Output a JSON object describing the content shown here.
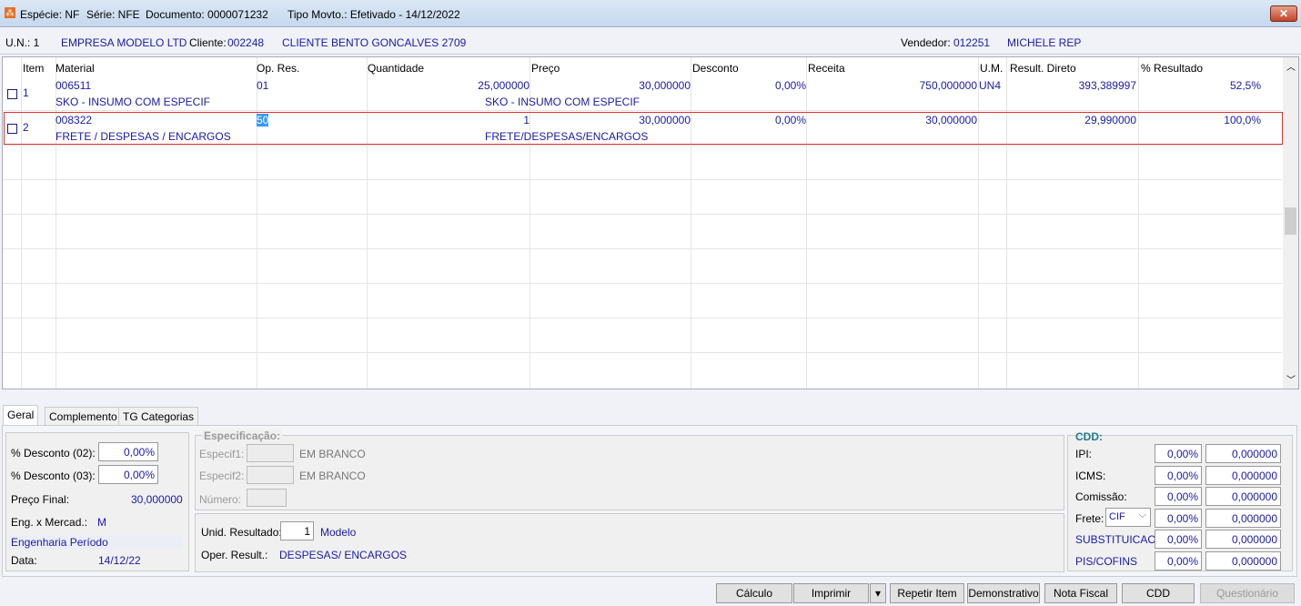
{
  "title": {
    "especie": "Espécie: NF",
    "serie": "Série: NFE",
    "documento": "Documento: 0000071232",
    "tipo": "Tipo Movto.: Efetivado - 14/12/2022",
    "close": "✕"
  },
  "info": {
    "un_label": "U.N.: 1",
    "empresa": "EMPRESA MODELO LTD",
    "cliente_label": "Cliente:",
    "cliente_code": "002248",
    "cliente_name": "CLIENTE BENTO GONCALVES 2709",
    "vendedor_label": "Vendedor:",
    "vendedor_code": "012251",
    "vendedor_name": "MICHELE REP"
  },
  "grid": {
    "columns": [
      "Item",
      "Material",
      "Op. Res.",
      "Quantidade",
      "Preço",
      "Desconto",
      "Receita",
      "U.M.",
      "Result. Direto",
      "% Resultado"
    ],
    "rows": [
      {
        "item": "1",
        "material": "006511",
        "op": "01",
        "quantidade": "25,000000",
        "preco": "30,000000",
        "desconto": "0,00%",
        "receita": "750,000000",
        "um": "UN4",
        "result": "393,389997",
        "pct": "52,5%",
        "desc1": "SKO - INSUMO COM ESPECIF",
        "desc2": "SKO - INSUMO COM ESPECIF"
      },
      {
        "item": "2",
        "material": "008322",
        "op": "50",
        "quantidade": "1",
        "preco": "30,000000",
        "desconto": "0,00%",
        "receita": "30,000000",
        "um": "",
        "result": "29,990000",
        "pct": "100,0%",
        "desc1": "FRETE / DESPESAS / ENCARGOS",
        "desc2": "FRETE/DESPESAS/ENCARGOS"
      }
    ]
  },
  "tabs": [
    "Geral",
    "Complemento",
    "TG Categorias"
  ],
  "geral": {
    "desc02_label": "% Desconto (02):",
    "desc02": "0,00%",
    "desc03_label": "% Desconto (03):",
    "desc03": "0,00%",
    "preco_final_label": "Preço Final:",
    "preco_final": "30,000000",
    "eng_label": "Eng. x Mercad.:",
    "eng": "M",
    "eng_periodo": "Engenharia Período",
    "data_label": "Data:",
    "data": "14/12/22"
  },
  "espec": {
    "title": "Especificação:",
    "especif1_label": "Especif1:",
    "especif1_text": "EM BRANCO",
    "especif2_label": "Especif2:",
    "especif2_text": "EM BRANCO",
    "numero_label": "Número:"
  },
  "unid": {
    "label": "Unid. Resultado:",
    "value": "1",
    "modelo": "Modelo",
    "oper_label": "Oper. Result.:",
    "oper": "DESPESAS/ ENCARGOS"
  },
  "cdd": {
    "title": "CDD:",
    "rows": [
      {
        "label": "IPI:",
        "pct": "0,00%",
        "val": "0,000000"
      },
      {
        "label": "ICMS:",
        "pct": "0,00%",
        "val": "0,000000"
      },
      {
        "label": "Comissão:",
        "pct": "0,00%",
        "val": "0,000000"
      },
      {
        "label": "Frete:",
        "pct": "0,00%",
        "val": "0,000000"
      },
      {
        "label": "SUBSTITUICAO",
        "pct": "0,00%",
        "val": "0,000000"
      },
      {
        "label": "PIS/COFINS",
        "pct": "0,00%",
        "val": "0,000000"
      }
    ],
    "frete_select": "CIF"
  },
  "buttons": [
    "Cálculo",
    "Imprimir",
    "Repetir Item",
    "Demonstrativo",
    "Nota Fiscal",
    "CDD",
    "Questionário"
  ]
}
